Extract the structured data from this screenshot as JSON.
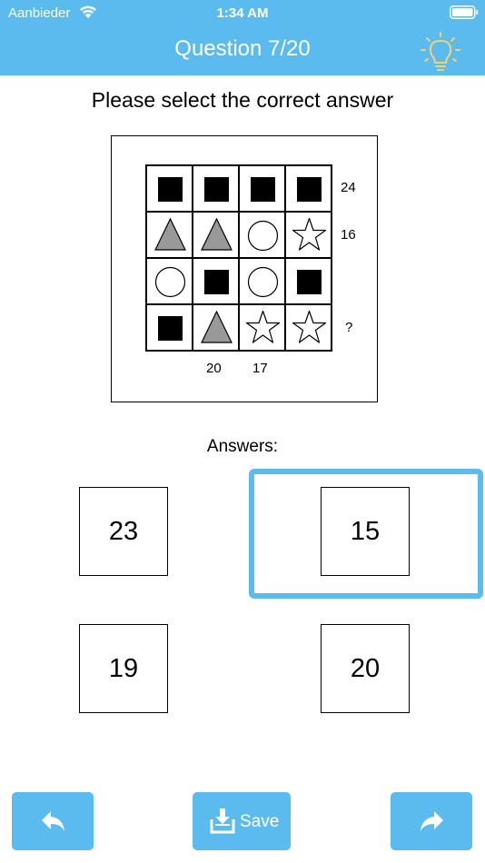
{
  "status_bar": {
    "carrier": "Aanbieder",
    "time": "1:34 AM"
  },
  "header": {
    "title": "Question 7/20",
    "hint_icon": "lightbulb-icon"
  },
  "prompt": "Please select the correct answer",
  "puzzle": {
    "rows": [
      [
        "square",
        "square",
        "square",
        "square"
      ],
      [
        "triangle",
        "triangle",
        "circle",
        "star"
      ],
      [
        "circle",
        "square",
        "circle",
        "square"
      ],
      [
        "square",
        "triangle",
        "star",
        "star"
      ]
    ],
    "row_sums": [
      "24",
      "16",
      "",
      "?"
    ],
    "column_sums": [
      "",
      "20",
      "17",
      ""
    ]
  },
  "answers_label": "Answers:",
  "answers": [
    "23",
    "15",
    "19",
    "20"
  ],
  "selected_answer": "15",
  "footer": {
    "back_icon": "reply-arrow-icon",
    "save_label": "Save",
    "save_icon": "download-tray-icon",
    "forward_icon": "forward-arrow-icon"
  },
  "colors": {
    "accent": "#5cbbee",
    "shape_fill_dark": "#000000",
    "shape_fill_gray": "#999999"
  }
}
